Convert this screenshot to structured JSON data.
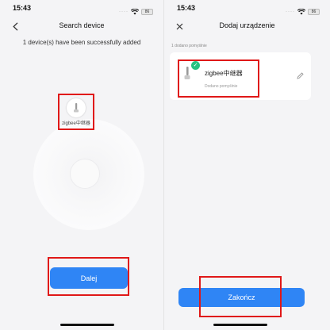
{
  "left": {
    "status_bar": {
      "time": "15:43",
      "battery": "86"
    },
    "nav": {
      "title": "Search device"
    },
    "success_message": "1 device(s) have been successfully added",
    "found_device": {
      "name": "zigbee中继器"
    },
    "next_button": "Dalej"
  },
  "right": {
    "status_bar": {
      "time": "15:43",
      "battery": "86"
    },
    "nav": {
      "title": "Dodaj urządzenie"
    },
    "added_count": "1 dodano pomyślnie",
    "device": {
      "name": "zigbee中继器",
      "status": "Dodano pomyślnie"
    },
    "finish_button": "Zakończ"
  },
  "colors": {
    "accent": "#2f85f5",
    "highlight_box": "#e01818",
    "success_badge": "#27c281"
  },
  "icons": [
    "wifi-icon",
    "battery-icon",
    "back-chevron-icon",
    "close-icon",
    "device-icon",
    "check-icon",
    "edit-pencil-icon"
  ]
}
